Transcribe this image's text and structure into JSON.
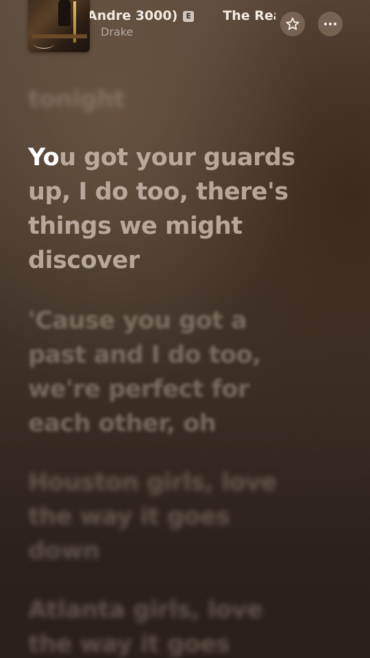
{
  "header": {
    "album": {
      "icon": "album-art-icon"
    },
    "song_title": "Andre 3000)",
    "explicit_badge": "E",
    "next_title": "The Rea",
    "artist": "Drake",
    "favorite_icon": "star-icon",
    "more_icon": "ellipsis-icon"
  },
  "lyrics": {
    "previous": "tonight",
    "current_sung": "Yo",
    "current_rest": "u got your guards up, I do too, there's things we might discover",
    "next": "'Cause you got a past and I do too, we're perfect for each other, oh",
    "later_1": "Houston girls, love the way it goes down",
    "later_2": "Atlanta girls, love the way it goes"
  },
  "colors": {
    "background_top": "#5a4a3c",
    "background_bottom": "#2a1f19",
    "active_lyric": "#ffffff",
    "inactive_lyric": "#cdbeb2"
  }
}
